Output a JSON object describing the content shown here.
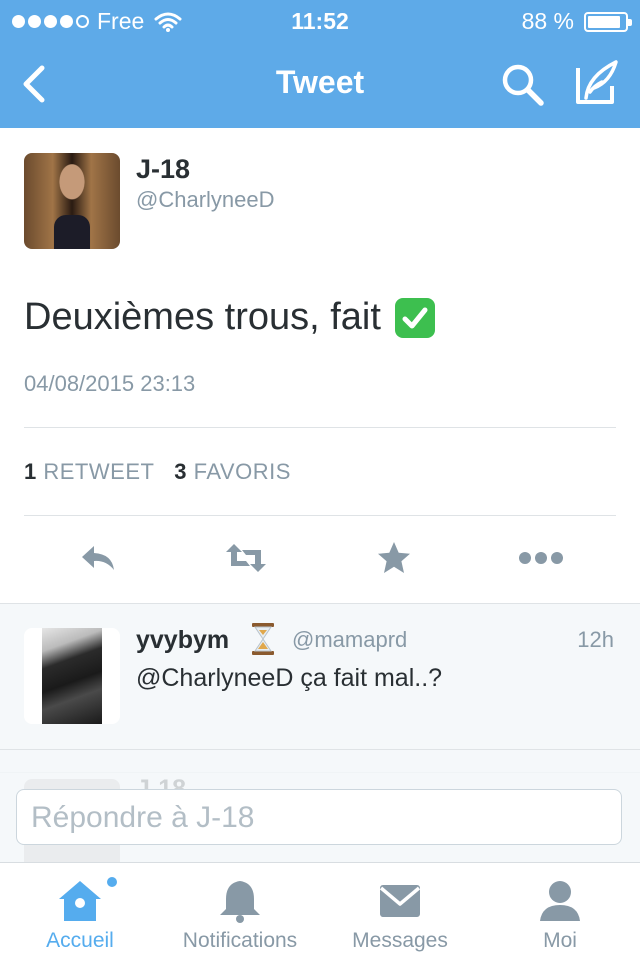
{
  "status_bar": {
    "carrier": "Free",
    "time": "11:52",
    "battery_text": "88 %",
    "battery_level": 0.88
  },
  "nav": {
    "title": "Tweet"
  },
  "tweet": {
    "author_name": "J-18",
    "author_handle": "@CharlyneeD",
    "text": "Deuxièmes trous, fait",
    "emoji": "white-heavy-check-mark",
    "date": "04/08/2015 23:13",
    "retweet_count": "1",
    "retweet_label": "RETWEET",
    "favorite_count": "3",
    "favorite_label": "FAVORIS"
  },
  "reply": {
    "name": "yvybym",
    "name_emoji": "hourglass",
    "handle": "@mamaprd",
    "time": "12h",
    "text": "@CharlyneeD ça fait mal..?"
  },
  "reply_box": {
    "placeholder": "Répondre à J-18"
  },
  "tabs": [
    {
      "label": "Accueil",
      "icon": "home-icon",
      "active": true
    },
    {
      "label": "Notifications",
      "icon": "bell-icon",
      "active": false
    },
    {
      "label": "Messages",
      "icon": "envelope-icon",
      "active": false
    },
    {
      "label": "Moi",
      "icon": "person-icon",
      "active": false
    }
  ],
  "colors": {
    "brand": "#5eaae8",
    "accent": "#55acee",
    "muted": "#8899a6",
    "text": "#292f33"
  }
}
